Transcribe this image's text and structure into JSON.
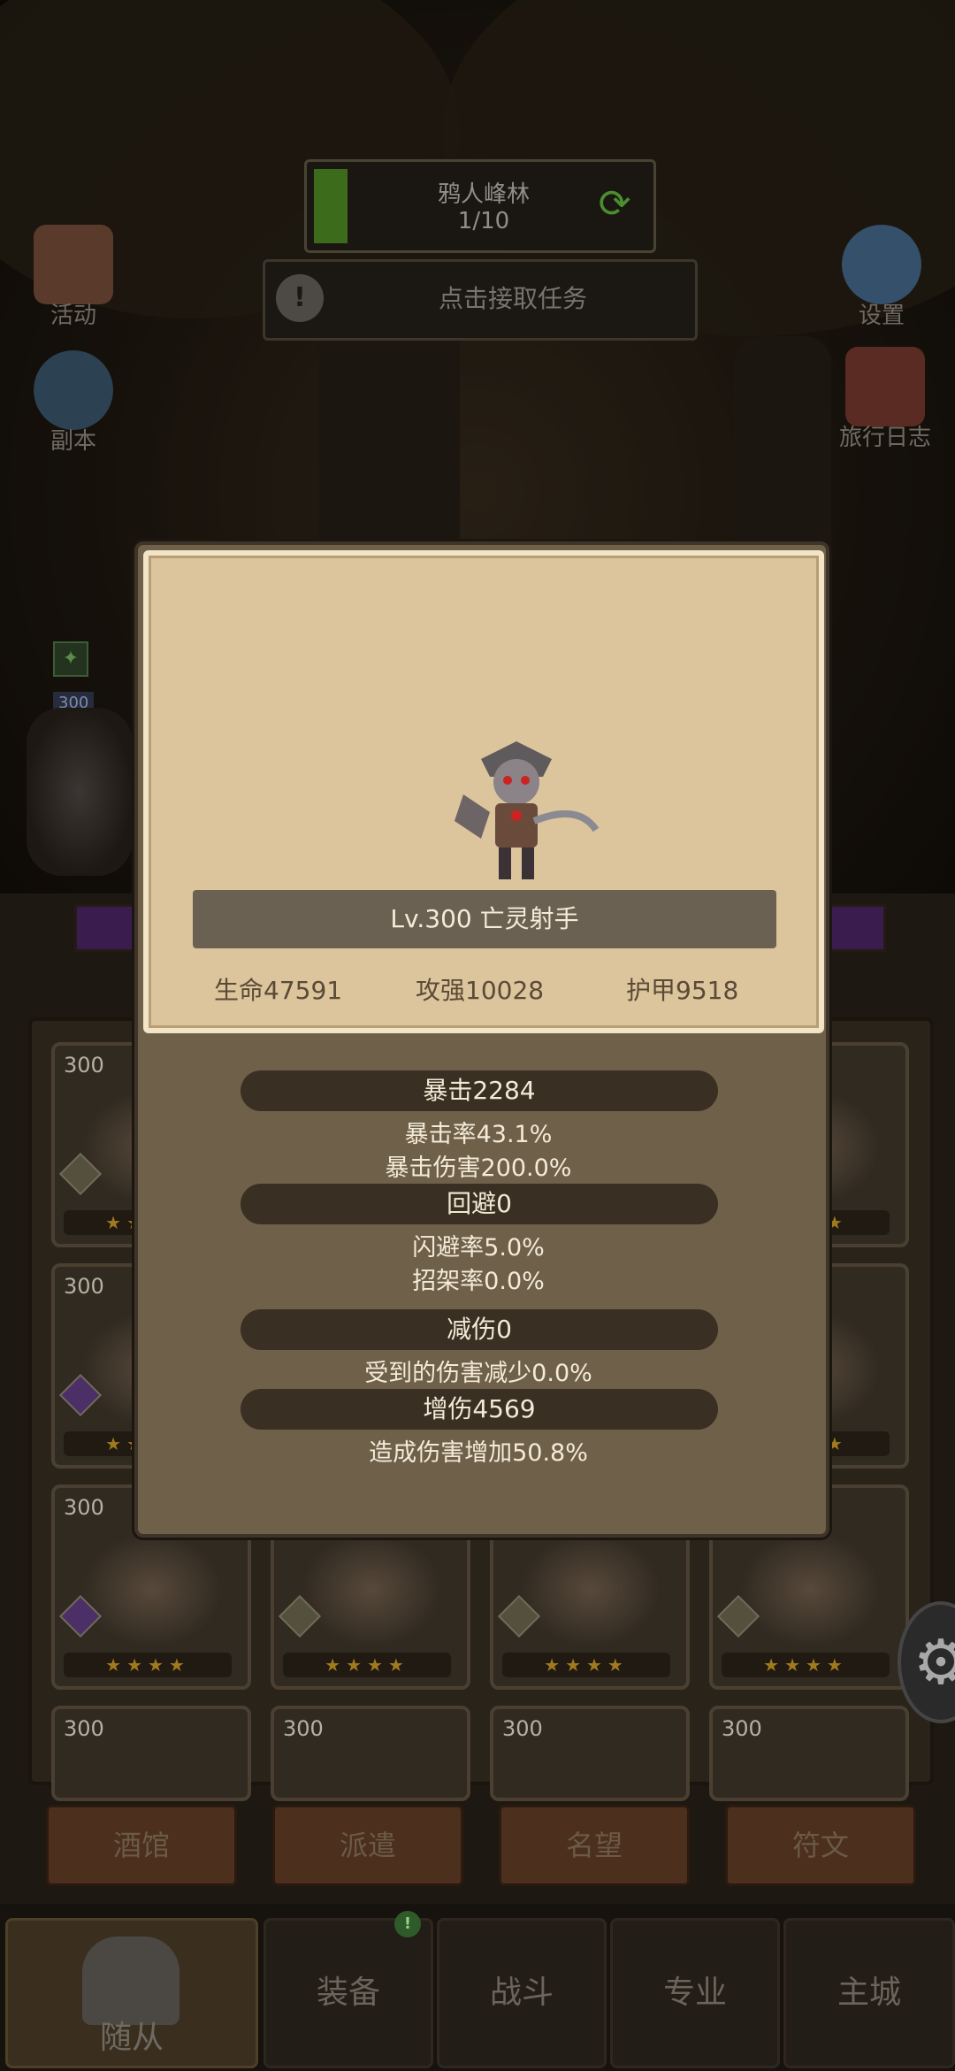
{
  "quest": {
    "name": "鸦人峰林",
    "progress": "1/10",
    "progress_fraction": 0.1
  },
  "task": {
    "label": "点击接取任务"
  },
  "side_left": [
    {
      "label": "活动",
      "icon": "activity-scroll-icon"
    },
    {
      "label": "副本",
      "icon": "dungeon-portal-icon"
    }
  ],
  "side_right": [
    {
      "label": "设置",
      "icon": "gear-icon"
    },
    {
      "label": "旅行日志",
      "icon": "travel-log-book-icon"
    }
  ],
  "hero": {
    "level": "300"
  },
  "roster": {
    "cards": [
      {
        "level": "300",
        "stars": "★★★★"
      },
      {
        "level": "300",
        "stars": "★★★★"
      },
      {
        "level": "300",
        "stars": "★★★★"
      },
      {
        "level": "300",
        "stars": "★★★★"
      },
      {
        "level": "300",
        "stars": "★★★★"
      },
      {
        "level": "300",
        "stars": "★★★★"
      },
      {
        "level": "300",
        "stars": "★★★★"
      },
      {
        "level": "300",
        "stars": "★★★★"
      },
      {
        "level": "300",
        "stars": "★★★★"
      },
      {
        "level": "300",
        "stars": "★★★★"
      },
      {
        "level": "300",
        "stars": ""
      },
      {
        "level": "300",
        "stars": ""
      },
      {
        "level": "300",
        "stars": ""
      },
      {
        "level": "300",
        "stars": ""
      }
    ]
  },
  "tabs": [
    "酒馆",
    "派遣",
    "名望",
    "符文"
  ],
  "nav": {
    "followers": "随从",
    "equipment": "装备",
    "battle": "战斗",
    "profession": "专业",
    "main_city": "主城"
  },
  "nav_badge": "!",
  "modal": {
    "name": "Lv.300 亡灵射手",
    "hp": "生命47591",
    "atk": "攻强10028",
    "armor": "护甲9518",
    "crit": "暴击2284",
    "crit_rate": "暴击率43.1%",
    "crit_dmg": "暴击伤害200.0%",
    "evade": "回避0",
    "dodge_rate": "闪避率5.0%",
    "parry_rate": "招架率0.0%",
    "reduce": "减伤0",
    "reduce_desc": "受到的伤害减少0.0%",
    "increase": "增伤4569",
    "increase_desc": "造成伤害增加50.8%"
  },
  "colors": {
    "accent_green": "#3d6b1c",
    "parchment": "#dcc49c",
    "pill": "#3a2f23"
  }
}
